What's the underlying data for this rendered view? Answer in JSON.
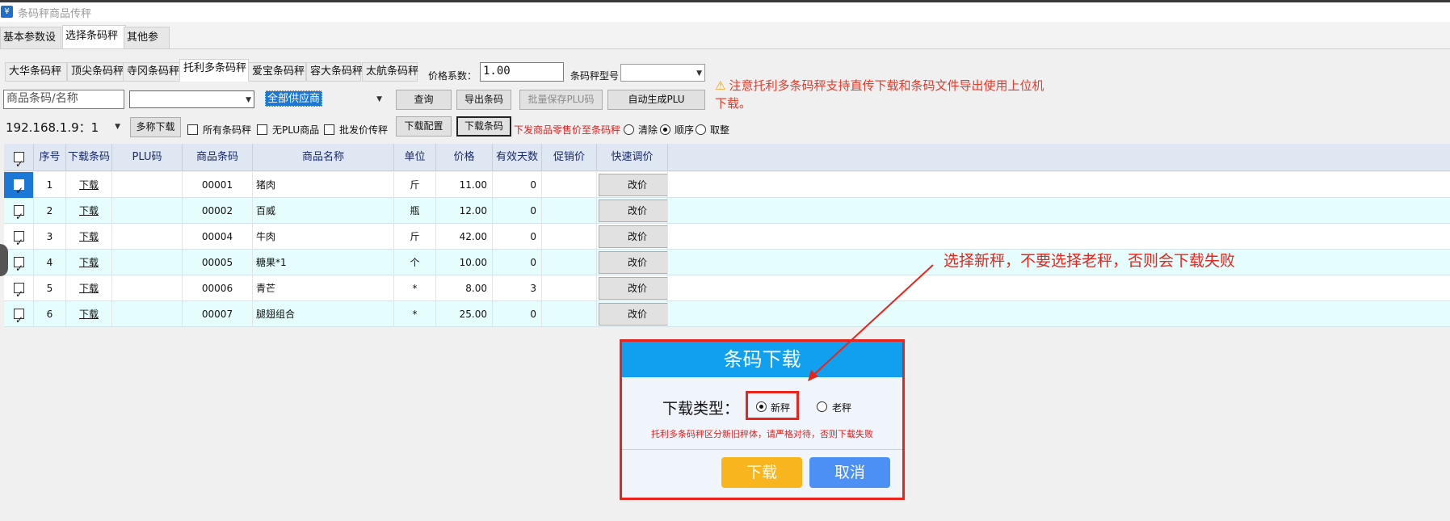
{
  "window": {
    "title": "条码秤商品传秤",
    "icon": "yen-icon"
  },
  "main_tabs": [
    {
      "label": "基本参数设置",
      "active": false
    },
    {
      "label": "选择条码秤",
      "active": true
    },
    {
      "label": "其他参数",
      "active": false
    }
  ],
  "scale_tabs": [
    {
      "label": "大华条码秤",
      "active": false
    },
    {
      "label": "顶尖条码秤",
      "active": false
    },
    {
      "label": "寺冈条码秤",
      "active": false
    },
    {
      "label": "托利多条码秤",
      "active": true
    },
    {
      "label": "爱宝条码秤",
      "active": false
    },
    {
      "label": "容大条码秤",
      "active": false
    },
    {
      "label": "太航条码秤",
      "active": false
    }
  ],
  "price_factor": {
    "label": "价格系数：",
    "value": "1.00"
  },
  "scale_model": {
    "label": "条码秤型号：",
    "value": ""
  },
  "warning": {
    "icon": "warning-icon",
    "text": "注意托利多条码秤支持直传下载和条码文件导出使用上位机下载。"
  },
  "toolbar": {
    "search_placeholder": "商品条码/名称",
    "category_value": "",
    "supplier_value": "全部供应商",
    "query_label": "查询",
    "export_label": "导出条码",
    "batch_save_label": "批量保存PLU码",
    "auto_plu_label": "自动生成PLU",
    "ip_value": "192.168.1.9：1",
    "multi_download_label": "多称下载",
    "all_scales_label": "所有条码秤",
    "no_plu_label": "无PLU商品",
    "wholesale_label": "批发价传秤",
    "download_config_label": "下载配置",
    "download_barcode_label": "下载条码",
    "member_price_note": "下发商品零售价至条码秤",
    "clear_label": "清除",
    "order_label": "顺序",
    "round_label": "取整",
    "option_selected": "顺序"
  },
  "grid": {
    "headers": [
      "",
      "序号",
      "下载条码",
      "PLU码",
      "商品条码",
      "商品名称",
      "单位",
      "价格",
      "有效天数",
      "促销价",
      "快速调价"
    ],
    "rows": [
      {
        "no": "1",
        "download": "下载",
        "plu": "",
        "barcode": "00001",
        "name": "猪肉",
        "unit": "斤",
        "price": "11.00",
        "days": "0",
        "promo": "",
        "action": "改价",
        "checked": true,
        "selected": true
      },
      {
        "no": "2",
        "download": "下载",
        "plu": "",
        "barcode": "00002",
        "name": "百威",
        "unit": "瓶",
        "price": "12.00",
        "days": "0",
        "promo": "",
        "action": "改价",
        "checked": true,
        "selected": false
      },
      {
        "no": "3",
        "download": "下载",
        "plu": "",
        "barcode": "00004",
        "name": "牛肉",
        "unit": "斤",
        "price": "42.00",
        "days": "0",
        "promo": "",
        "action": "改价",
        "checked": true,
        "selected": false
      },
      {
        "no": "4",
        "download": "下载",
        "plu": "",
        "barcode": "00005",
        "name": "糖果*1",
        "unit": "个",
        "price": "10.00",
        "days": "0",
        "promo": "",
        "action": "改价",
        "checked": true,
        "selected": false
      },
      {
        "no": "5",
        "download": "下载",
        "plu": "",
        "barcode": "00006",
        "name": "青芒",
        "unit": "*",
        "price": "8.00",
        "days": "3",
        "promo": "",
        "action": "改价",
        "checked": true,
        "selected": false
      },
      {
        "no": "6",
        "download": "下载",
        "plu": "",
        "barcode": "00007",
        "name": "腿翅组合",
        "unit": "*",
        "price": "25.00",
        "days": "0",
        "promo": "",
        "action": "改价",
        "checked": true,
        "selected": false
      }
    ]
  },
  "dialog": {
    "title": "条码下载",
    "type_label": "下载类型：",
    "option_new": "新秤",
    "option_old": "老秤",
    "selected": "新秤",
    "warning": "托利多条码秤区分新旧秤体，请严格对待，否则下载失败",
    "download_label": "下载",
    "cancel_label": "取消"
  },
  "annotation": {
    "text": "选择新秤，不要选择老秤，否则会下载失败",
    "color": "#e8241c"
  },
  "colors": {
    "accent": "#10a0ef",
    "warning": "#e8241c",
    "row_alt": "#e6fdfd",
    "header": "#dfe7f3",
    "selection": "#1c78d6"
  }
}
